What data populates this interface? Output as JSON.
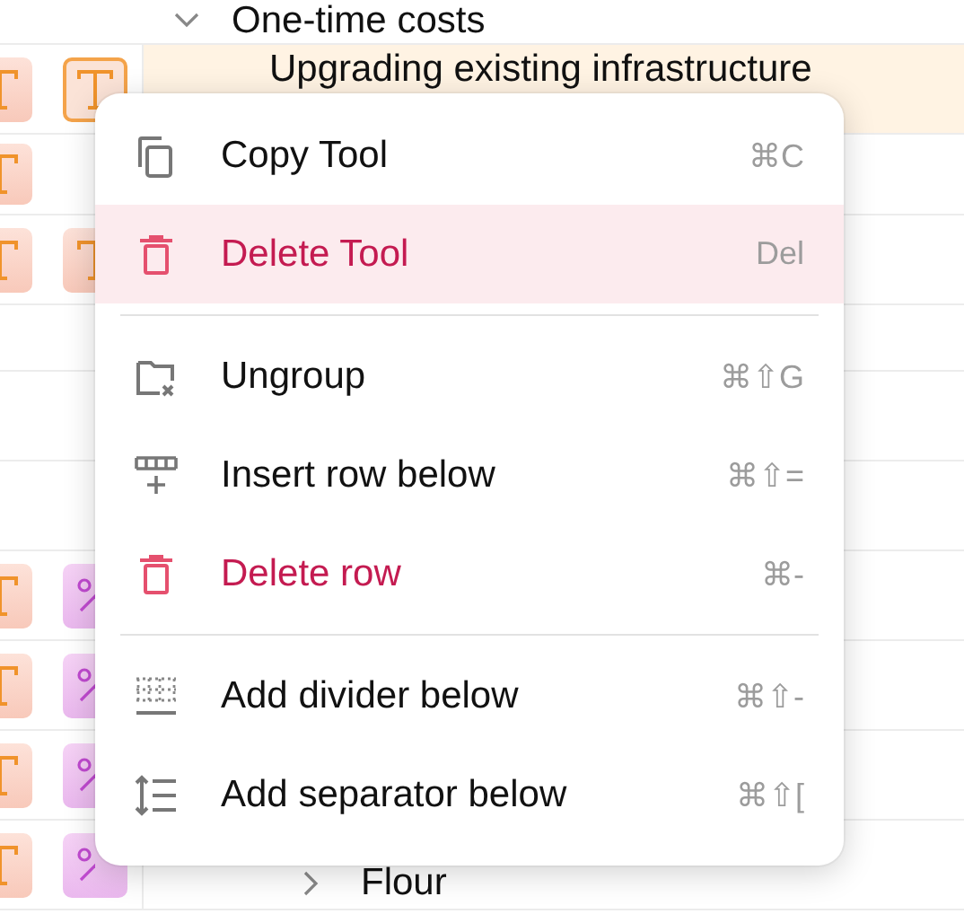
{
  "table": {
    "rows": [
      {
        "kind": "group",
        "label": "One-time costs",
        "cells": [],
        "highlighted": false
      },
      {
        "kind": "item",
        "label": "Upgrading existing infrastructure",
        "cells": [
          {
            "kind": "text",
            "selected": false
          },
          {
            "kind": "text",
            "selected": true
          }
        ],
        "highlighted": true
      },
      {
        "kind": "item",
        "cells": [
          {
            "kind": "text",
            "selected": false
          }
        ],
        "highlighted": false
      },
      {
        "kind": "item",
        "cells": [
          {
            "kind": "text",
            "selected": false
          },
          {
            "kind": "text",
            "selected": false
          }
        ],
        "highlighted": false
      },
      {
        "kind": "item",
        "cells": [],
        "highlighted": false
      },
      {
        "kind": "item",
        "cells": [],
        "highlighted": false
      },
      {
        "kind": "item",
        "cells": [],
        "highlighted": false
      },
      {
        "kind": "item",
        "cells": [
          {
            "kind": "text",
            "selected": false
          },
          {
            "kind": "percent",
            "selected": false
          }
        ],
        "highlighted": false
      },
      {
        "kind": "item",
        "cells": [
          {
            "kind": "text",
            "selected": false
          },
          {
            "kind": "percent",
            "selected": false
          }
        ],
        "highlighted": false
      },
      {
        "kind": "item",
        "cells": [
          {
            "kind": "text",
            "selected": false
          },
          {
            "kind": "percent",
            "selected": false
          }
        ],
        "highlighted": false
      },
      {
        "kind": "leaf",
        "label": "Flour",
        "cells": [
          {
            "kind": "text",
            "selected": false
          },
          {
            "kind": "percent",
            "selected": false
          }
        ],
        "highlighted": false
      }
    ]
  },
  "context_menu": {
    "items": [
      {
        "kind": "item",
        "label": "Copy Tool",
        "shortcut": "⌘C",
        "danger": false,
        "selected": false
      },
      {
        "kind": "item",
        "label": "Delete Tool",
        "shortcut": "Del",
        "danger": true,
        "selected": true
      },
      {
        "kind": "divider"
      },
      {
        "kind": "item",
        "label": "Ungroup",
        "shortcut": "⌘⇧G",
        "danger": false,
        "selected": false
      },
      {
        "kind": "item",
        "label": "Insert row below",
        "shortcut": "⌘⇧=",
        "danger": false,
        "selected": false
      },
      {
        "kind": "item",
        "label": "Delete row",
        "shortcut": "⌘-",
        "danger": true,
        "selected": false
      },
      {
        "kind": "divider"
      },
      {
        "kind": "item",
        "label": "Add divider below",
        "shortcut": "⌘⇧-",
        "danger": false,
        "selected": false
      },
      {
        "kind": "item",
        "label": "Add separator below",
        "shortcut": "⌘⇧[",
        "danger": false,
        "selected": false
      }
    ]
  }
}
